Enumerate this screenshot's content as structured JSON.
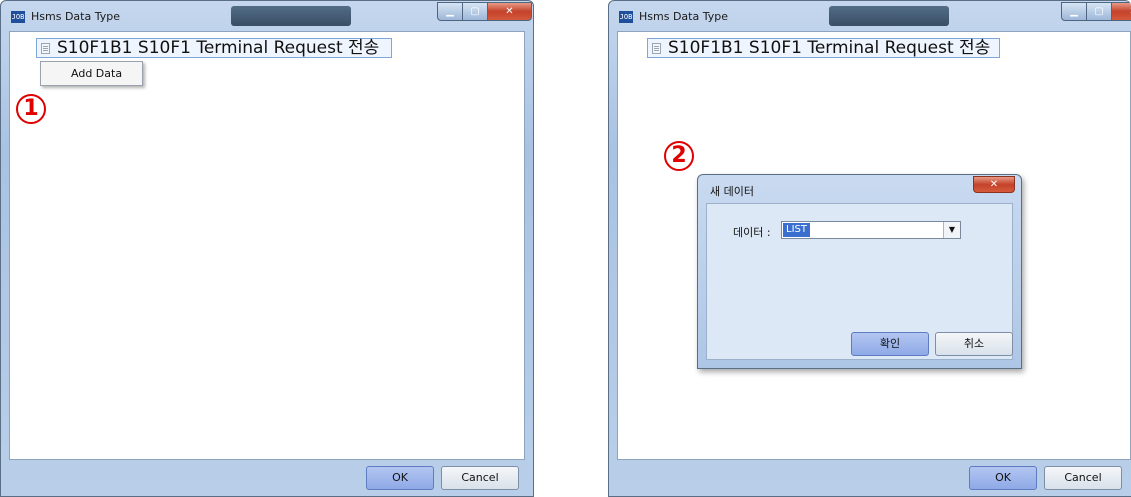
{
  "left_window": {
    "title": "Hsms Data Type",
    "app_icon_text": "JOB",
    "tree_root": "S10F1B1 S10F1 Terminal Request 전송",
    "context_menu_item": "Add Data",
    "step_marker": "1",
    "ok_label": "OK",
    "cancel_label": "Cancel"
  },
  "right_window": {
    "title": "Hsms Data Type",
    "app_icon_text": "JOB",
    "tree_root": "S10F1B1 S10F1 Terminal Request 전송",
    "step_marker": "2",
    "ok_label": "OK",
    "cancel_label": "Cancel"
  },
  "dialog": {
    "title": "새 데이터",
    "field_label": "데이터 :",
    "selected_value": "LIST",
    "confirm_label": "확인",
    "cancel_label": "취소"
  },
  "colors": {
    "step_marker": "#e00000",
    "selection": "#3a6fd0",
    "primary_button": "#8ea9e6"
  }
}
